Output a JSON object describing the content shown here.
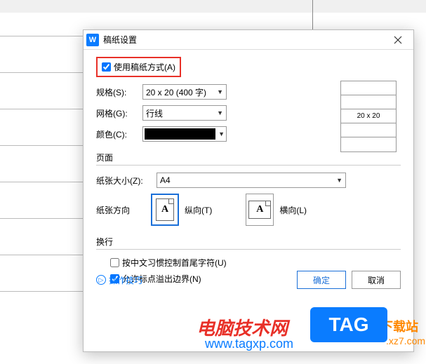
{
  "dialog": {
    "title": "稿纸设置",
    "use_grid_paper": {
      "label": "使用稿纸方式(A)",
      "checked": true
    },
    "spec": {
      "label": "规格(S):",
      "value": "20 x 20 (400 字)"
    },
    "grid": {
      "label": "网格(G):",
      "value": "行线"
    },
    "color": {
      "label": "颜色(C):",
      "value": "#000000"
    },
    "preview": {
      "text": "20 x 20"
    },
    "page_section": "页面",
    "paper_size": {
      "label": "纸张大小(Z):",
      "value": "A4"
    },
    "orient": {
      "label": "纸张方向",
      "portrait": "纵向(T)",
      "landscape": "横向(L)"
    },
    "wrap_section": "换行",
    "wrap_cjk": {
      "label": "按中文习惯控制首尾字符(U)",
      "checked": false
    },
    "wrap_punct": {
      "label": "允许标点溢出边界(N)",
      "checked": true
    },
    "tips": "操作技巧",
    "ok": "确定",
    "cancel": "取消"
  },
  "watermarks": {
    "site1": "电脑技术网",
    "url1": "www.tagxp.com",
    "tag": "TAG",
    "site2": "下载站",
    "url2": ".xz7.com"
  }
}
